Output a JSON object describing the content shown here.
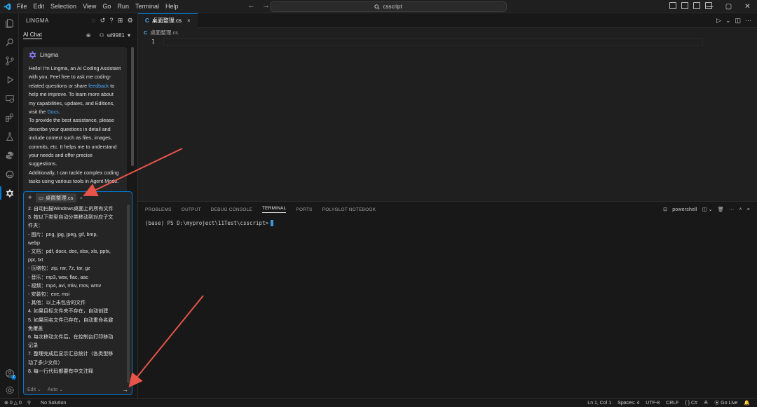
{
  "menu": [
    "File",
    "Edit",
    "Selection",
    "View",
    "Go",
    "Run",
    "Terminal",
    "Help"
  ],
  "search": {
    "text": "csscript"
  },
  "sidebar": {
    "title": "LINGMA",
    "chat_tab": "AI Chat",
    "user": "wl9981"
  },
  "chat": {
    "bot_name": "Lingma",
    "msg": {
      "p1": "Hello! I'm Lingma, an AI Coding Assistant with you. Feel free to ask me coding-related questions or share",
      "p1_link": "feedback",
      "p2": "to help me improve. To learn more about my capabilities, updates, and Editions, visit the",
      "p2_link": "Docs",
      "p3": "To provide the best assistance, please describe your questions in detail and include context such as files, images, commits, etc. It helps me to understand your needs and offer precise suggestions.",
      "p4": "Additionally, I can tackle complex coding tasks using various tools in Agent Mode."
    },
    "context_file": "桌面整理.cs",
    "prompt_lines": [
      "2. 自动扫描Windows桌面上的所有文件",
      "3. 按以下类型自动分类移动到对应子文",
      "件夹：",
      "  - 图片：png, jpg, jpeg, gif, bmp,",
      "webp",
      "  - 文档：pdf, docx, doc, xlsx, xls, pptx,",
      "ppt, txt",
      "  - 压缩包：zip, rar, 7z, tar, gz",
      "  - 音乐：mp3, wav, flac, aac",
      "  - 视频：mp4, avi, mkv, mov, wmv",
      "  - 安装包：exe, msi",
      "  - 其他：以上未包含的文件",
      "4. 如果目标文件夹不存在，自动创建",
      "5. 如果同名文件已存在，自动重命名避",
      "免覆盖",
      "6. 每次移动文件后，在控制台打印移动",
      "记录",
      "7. 整理完成后显示汇总统计（各类型移",
      "动了多少文件）",
      "8. 每一行代码都要有中文注释"
    ],
    "mode": "Edit",
    "model": "Auto"
  },
  "editor": {
    "tab": "桌面整理.cs",
    "breadcrumb": "桌面整理.cs",
    "line_number": "1"
  },
  "panel": {
    "tabs": [
      "PROBLEMS",
      "OUTPUT",
      "DEBUG CONSOLE",
      "TERMINAL",
      "PORTS",
      "POLYGLOT NOTEBOOK"
    ],
    "active_tab": "TERMINAL",
    "shell": "powershell",
    "terminal_line": "(base) PS D:\\myproject\\11Test\\csscript>"
  },
  "status": {
    "errors": "0",
    "warnings": "0",
    "solution": "No Solution",
    "position": "Ln 1, Col 1",
    "spaces": "Spaces: 4",
    "encoding": "UTF-8",
    "eol": "CRLF",
    "language": "C#",
    "golive": "Go Live"
  },
  "colors": {
    "accent": "#0078d4",
    "arrow": "#e8534a",
    "link": "#4daafc"
  }
}
